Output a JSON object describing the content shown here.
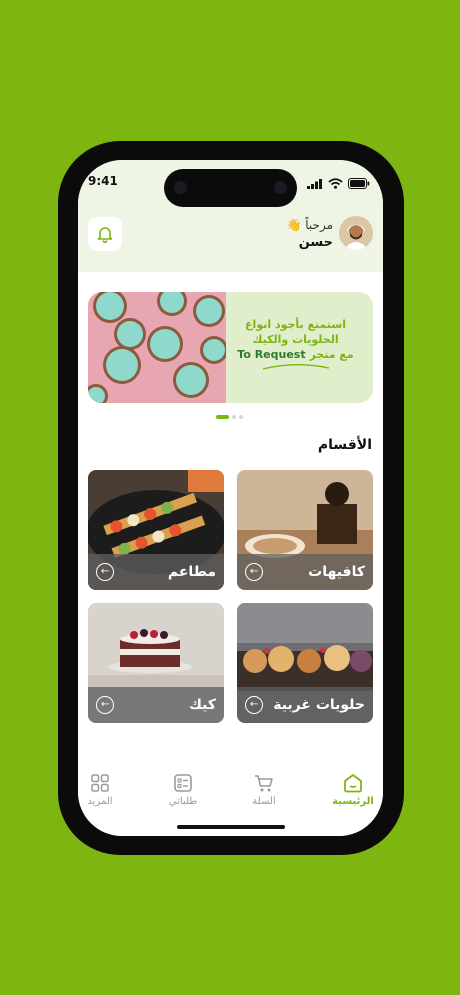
{
  "status_bar": {
    "time": "9:41"
  },
  "header": {
    "greeting": "مرحباً 👋",
    "user_name": "حسن"
  },
  "banner": {
    "line1": "استمتع بأجود انواع",
    "line2": "الحلويات والكيك",
    "line3_prefix": "مع متجر",
    "brand": "To Request"
  },
  "carousel": {
    "pages": 3,
    "active": 0
  },
  "categories": {
    "title": "الأقسام",
    "items": [
      {
        "label": "كافيهات"
      },
      {
        "label": "مطاعم"
      },
      {
        "label": "حلويات غربية"
      },
      {
        "label": "كيك"
      }
    ]
  },
  "tabbar": {
    "items": [
      {
        "label": "الرئيسية",
        "icon": "home-icon",
        "active": true
      },
      {
        "label": "السلة",
        "icon": "cart-icon",
        "active": false
      },
      {
        "label": "طلباتي",
        "icon": "orders-icon",
        "active": false
      },
      {
        "label": "المزيد",
        "icon": "grid-icon",
        "active": false
      }
    ]
  },
  "colors": {
    "accent": "#7db511",
    "background": "#7db511",
    "header_tint": "#eff5e4"
  }
}
